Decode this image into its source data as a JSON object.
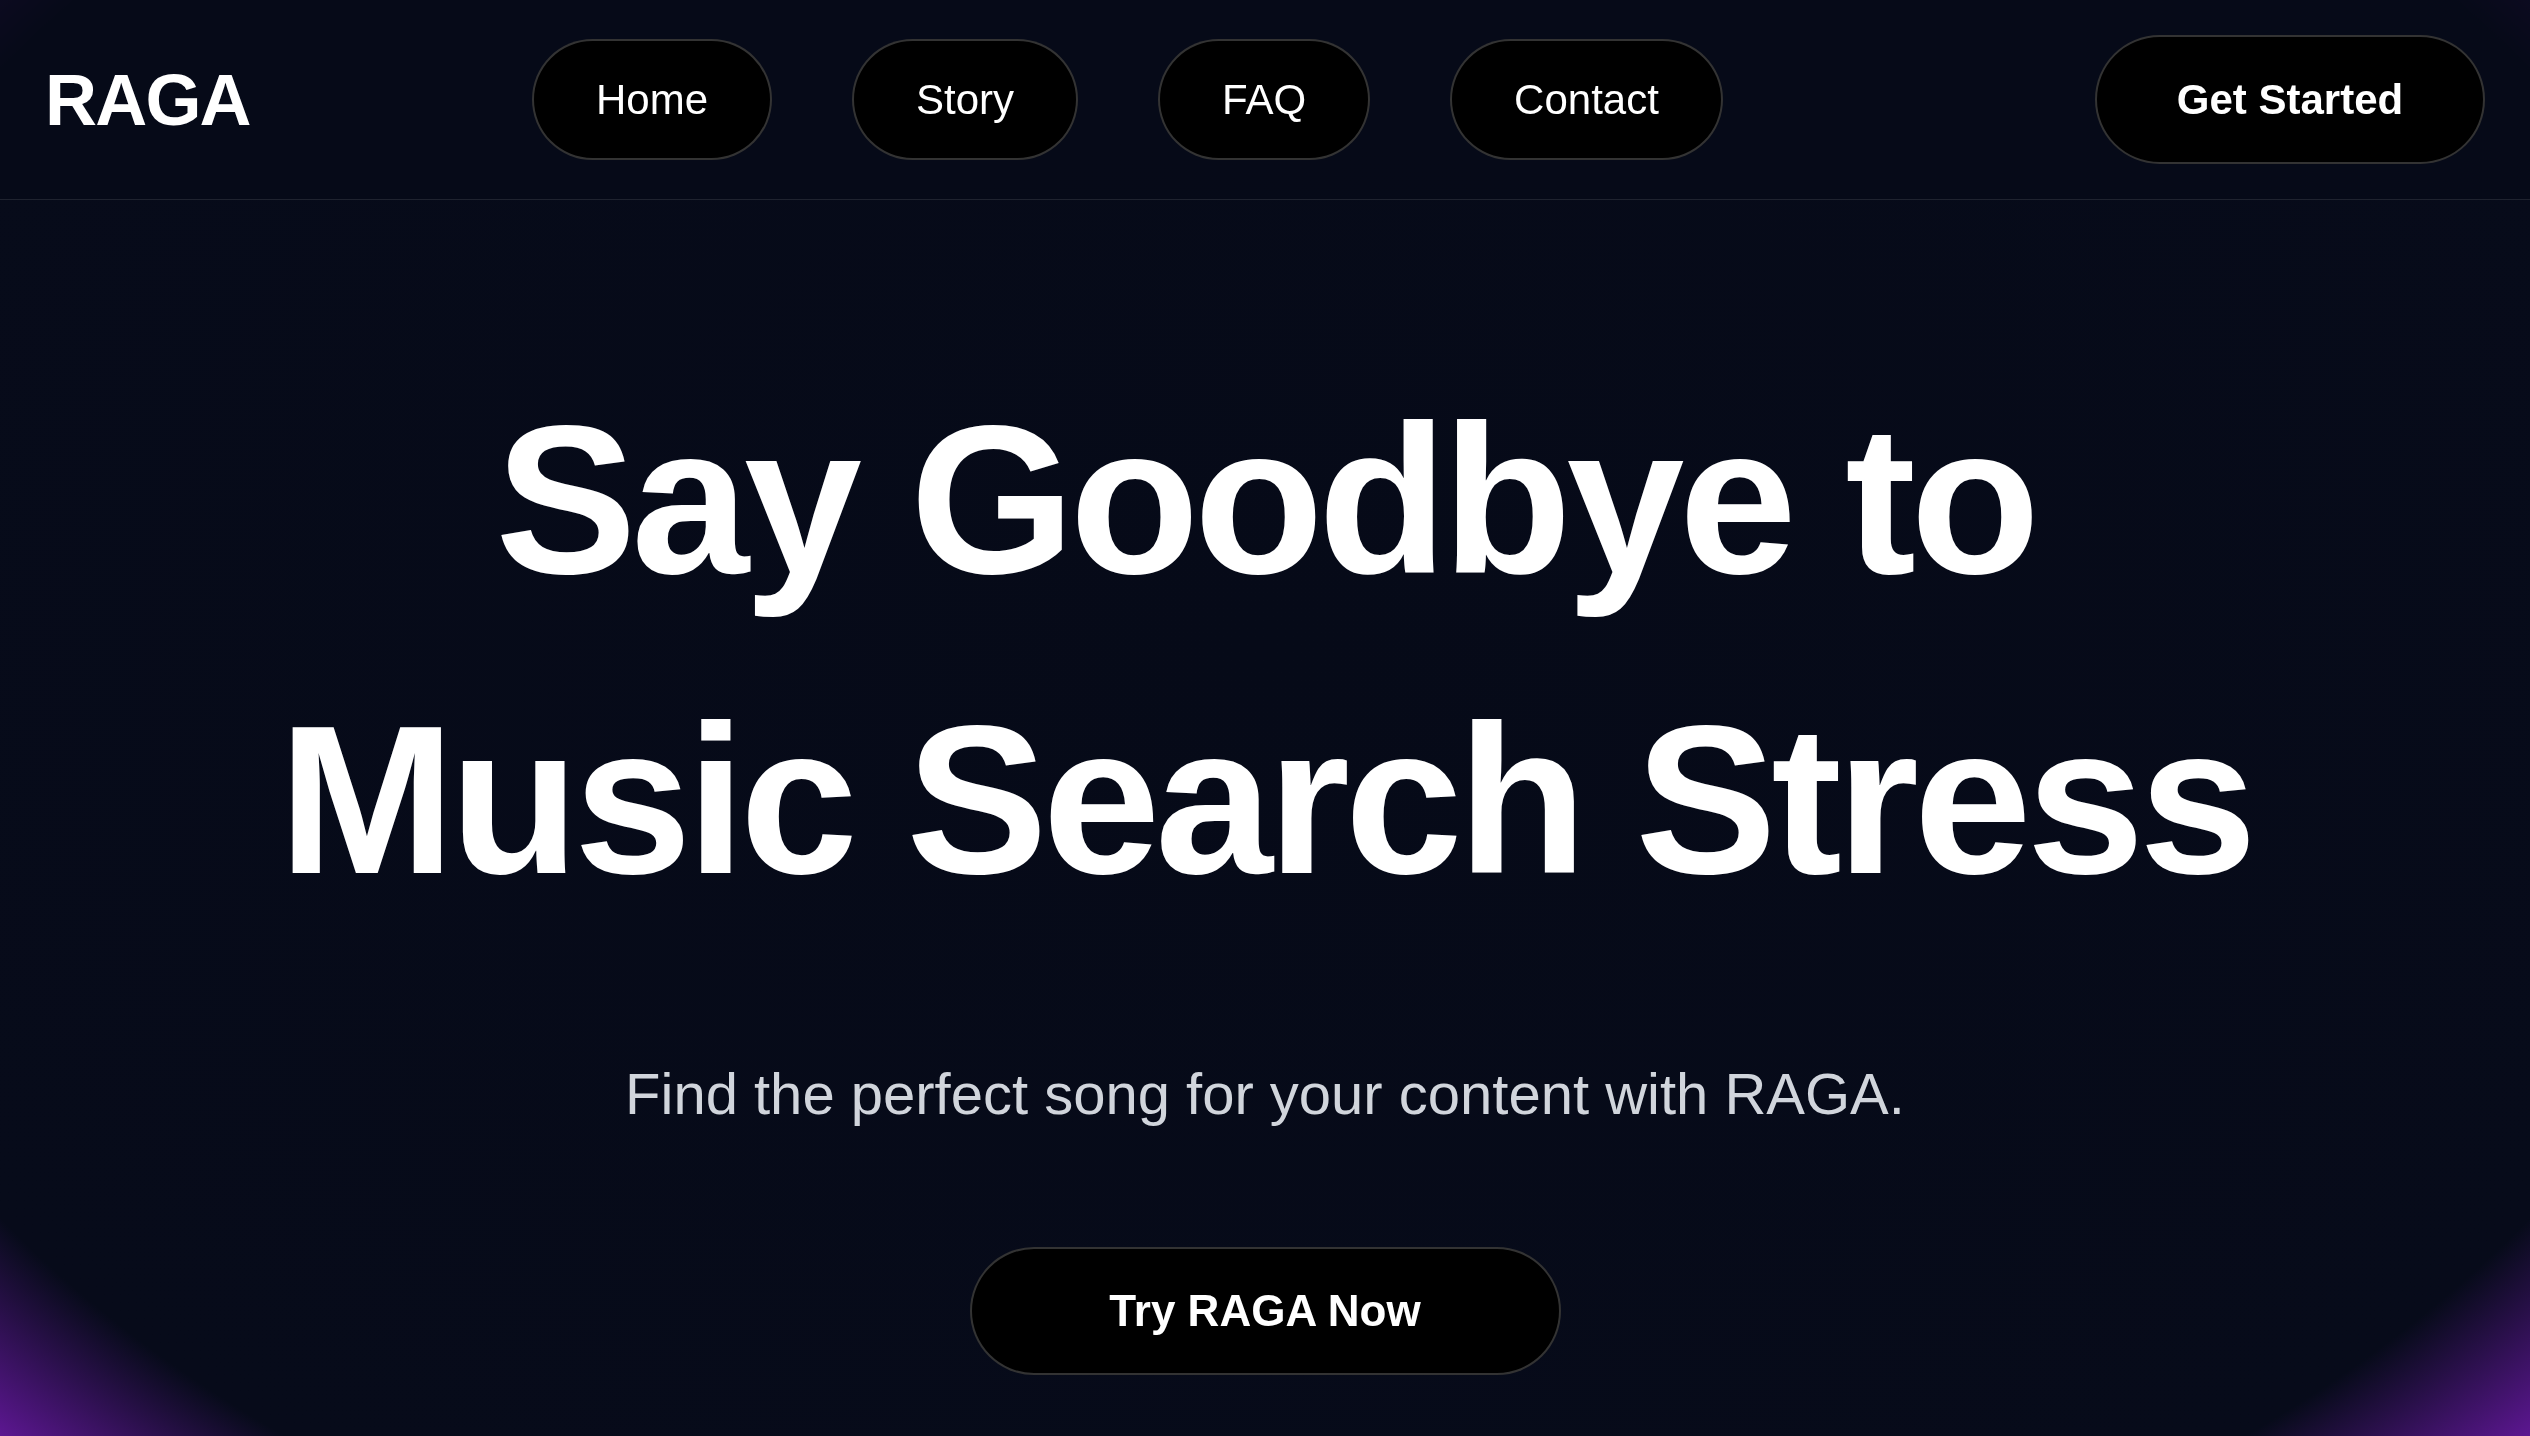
{
  "logo": "RAGA",
  "nav": [
    "Home",
    "Story",
    "FAQ",
    "Contact"
  ],
  "nav_cta": "Get Started",
  "headline": [
    "Say Goodbye to",
    "Music Search Stress"
  ],
  "subtitle": "Find the perfect song for your content with RAGA.",
  "cta": "Try RAGA Now"
}
